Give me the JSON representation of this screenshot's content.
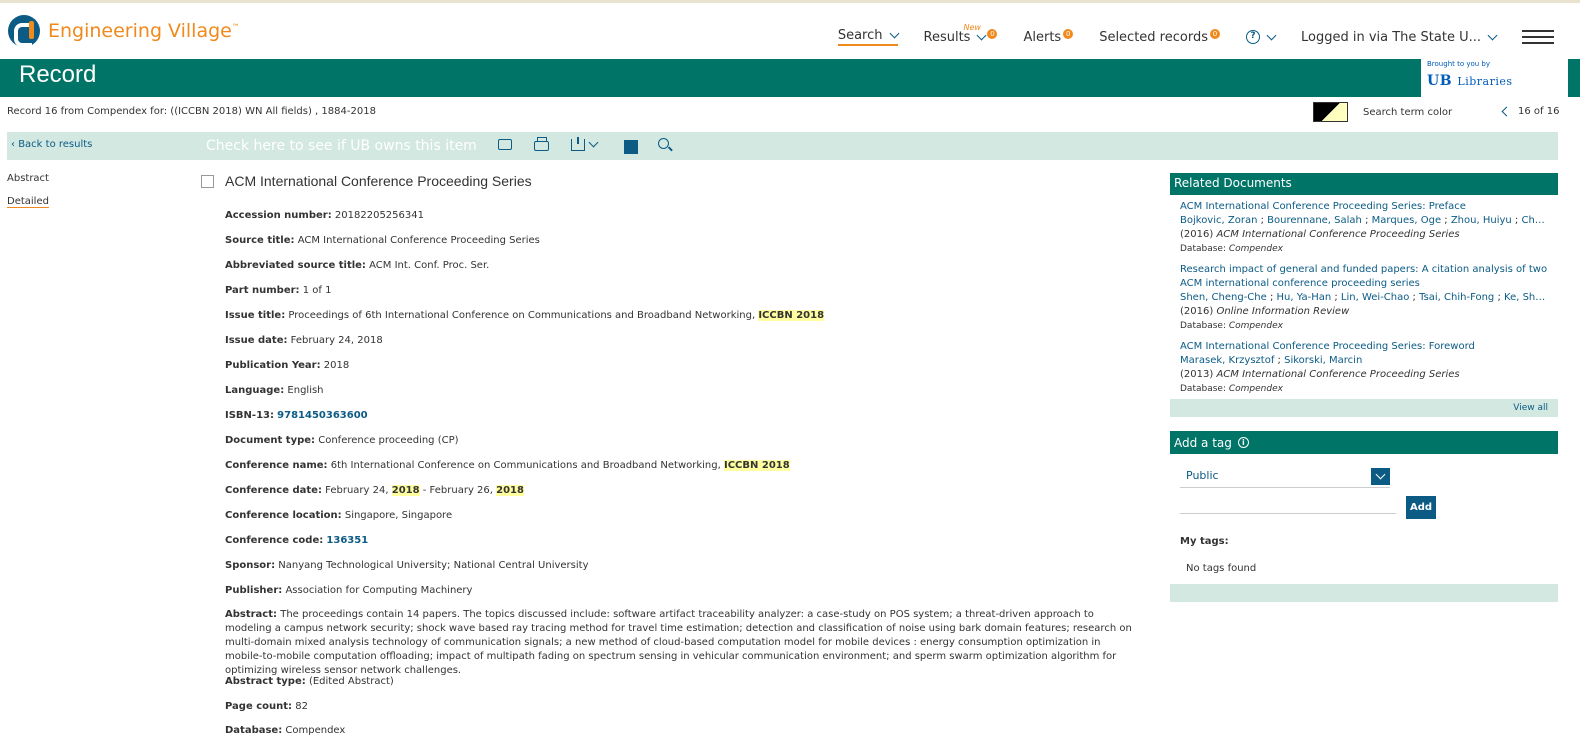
{
  "header": {
    "brand": "Engineering Village",
    "brand_tm": "™",
    "nav": {
      "search": "Search",
      "results": "Results",
      "results_new": "New",
      "results_badge": "0",
      "alerts": "Alerts",
      "alerts_badge": "0",
      "selected": "Selected records",
      "selected_badge": "0",
      "help_icon": "?",
      "login": "Logged in via The State U..."
    }
  },
  "record_bar": {
    "title": "Record",
    "brought_by": "Brought to you by",
    "library_logo_ub": "UB",
    "library_logo_text": "Libraries"
  },
  "subinfo": {
    "record_text": "Record 16 from Compendex for: ((ICCBN 2018) WN All fields) , 1884-2018",
    "term_color_label": "Search term color",
    "pager": "16 of 16"
  },
  "toolbar": {
    "back": "Back to results",
    "owns": "Check here to see if UB owns this item"
  },
  "leftnav": {
    "abstract": "Abstract",
    "detailed": "Detailed"
  },
  "document": {
    "title": "ACM International Conference Proceeding Series",
    "fields": {
      "accession": {
        "label": "Accession number:",
        "value": "20182205256341"
      },
      "source_title": {
        "label": "Source title:",
        "value": "ACM International Conference Proceeding Series"
      },
      "abbrev": {
        "label": "Abbreviated source title:",
        "value": "ACM Int. Conf. Proc. Ser."
      },
      "part": {
        "label": "Part number:",
        "value": "1 of 1"
      },
      "issue_title": {
        "label": "Issue title:",
        "value": "Proceedings of 6th International Conference on Communications and Broadband Networking,",
        "highlight": "ICCBN 2018"
      },
      "issue_date": {
        "label": "Issue date:",
        "value": "February 24, 2018"
      },
      "pub_year": {
        "label": "Publication Year:",
        "value": "2018"
      },
      "language": {
        "label": "Language:",
        "value": "English"
      },
      "isbn": {
        "label": "ISBN-13:",
        "value": "9781450363600"
      },
      "doc_type": {
        "label": "Document type:",
        "value": "Conference proceeding (CP)"
      },
      "conf_name": {
        "label": "Conference name:",
        "value": "6th International Conference on Communications and Broadband Networking,",
        "highlight": "ICCBN 2018"
      },
      "conf_date": {
        "label": "Conference date:",
        "value_a": "February 24,",
        "hl_a": "2018",
        "value_b": "- February 26,",
        "hl_b": "2018"
      },
      "conf_loc": {
        "label": "Conference location:",
        "value": "Singapore, Singapore"
      },
      "conf_code": {
        "label": "Conference code:",
        "value": "136351"
      },
      "sponsor": {
        "label": "Sponsor:",
        "value": "Nanyang Technological University; National Central University"
      },
      "publisher": {
        "label": "Publisher:",
        "value": "Association for Computing Machinery"
      },
      "abstract": {
        "label": "Abstract:",
        "value": "The proceedings contain 14 papers. The topics discussed include: software artifact traceability analyzer: a case-study on POS system; a threat-driven approach to modeling a campus network security; shock wave based ray tracing method for travel time estimation; detection and classification of noise using bark domain features; research on multi-domain mixed analysis technology of communication signals; a new method of cloud-based computation model for mobile devices : energy consumption optimization in mobile-to-mobile computation offloading; impact of multipath fading on spectrum sensing in vehicular communication environment; and sperm swarm optimization algorithm for optimizing wireless sensor network challenges."
      },
      "abstract_type": {
        "label": "Abstract type:",
        "value": "(Edited Abstract)"
      },
      "page_count": {
        "label": "Page count:",
        "value": "82"
      },
      "database": {
        "label": "Database:",
        "value": "Compendex"
      }
    }
  },
  "related": {
    "heading": "Related Documents",
    "items": [
      {
        "title": "ACM International Conference Proceeding Series: Preface",
        "authors": [
          "Bojkovic, Zoran",
          "Bourennane, Salah",
          "Marques, Oge",
          "Zhou, Huiyu",
          "Chaki, ..."
        ],
        "year": "(2016)",
        "source": "ACM International Conference Proceeding Series",
        "db_label": "Database:",
        "db": "Compendex"
      },
      {
        "title": "Research impact of general and funded papers: A citation analysis of two ACM international conference proceeding series",
        "authors": [
          "Shen, Cheng-Che",
          "Hu, Ya-Han",
          "Lin, Wei-Chao",
          "Tsai, Chih-Fong",
          "Ke, Shih-..."
        ],
        "year": "(2016)",
        "source": "Online Information Review",
        "db_label": "Database:",
        "db": "Compendex"
      },
      {
        "title": "ACM International Conference Proceeding Series: Foreword",
        "authors": [
          "Marasek, Krzysztof",
          "Sikorski, Marcin"
        ],
        "year": "(2013)",
        "source": "ACM International Conference Proceeding Series",
        "db_label": "Database:",
        "db": "Compendex"
      }
    ],
    "view_all": "View all"
  },
  "tags": {
    "heading": "Add a tag",
    "info_icon": "i",
    "visibility": "Public",
    "add": "Add",
    "my_tags": "My tags:",
    "none": "No tags found"
  },
  "colors": {
    "brand_orange": "#f08a1c",
    "teal": "#007567",
    "link_blue": "#0b5b85",
    "light_teal": "#d2e8e1",
    "highlight": "#ffffa0"
  }
}
